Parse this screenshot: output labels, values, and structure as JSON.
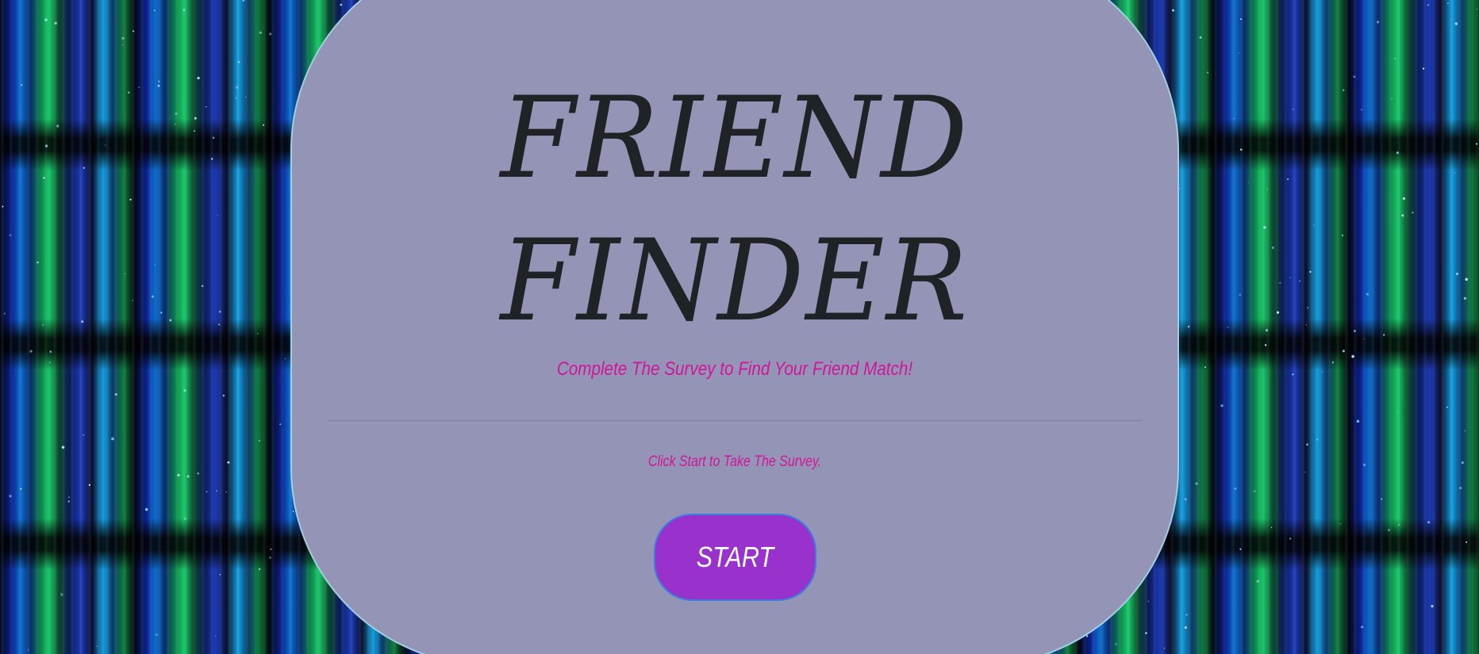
{
  "page": {
    "title_line_1": "FRIEND",
    "title_line_2": "FINDER",
    "subtitle": "Complete The Survey to Find Your Friend Match!",
    "instruction": "Click Start to Take The Survey.",
    "start_button_label": "START"
  },
  "colors": {
    "card_background": "#9394b6",
    "card_border": "#9fcfe0",
    "title_text": "#202326",
    "accent_text": "#d2159a",
    "button_background": "#9932cc",
    "button_border": "#3d7be0",
    "button_text": "#ffffff"
  }
}
